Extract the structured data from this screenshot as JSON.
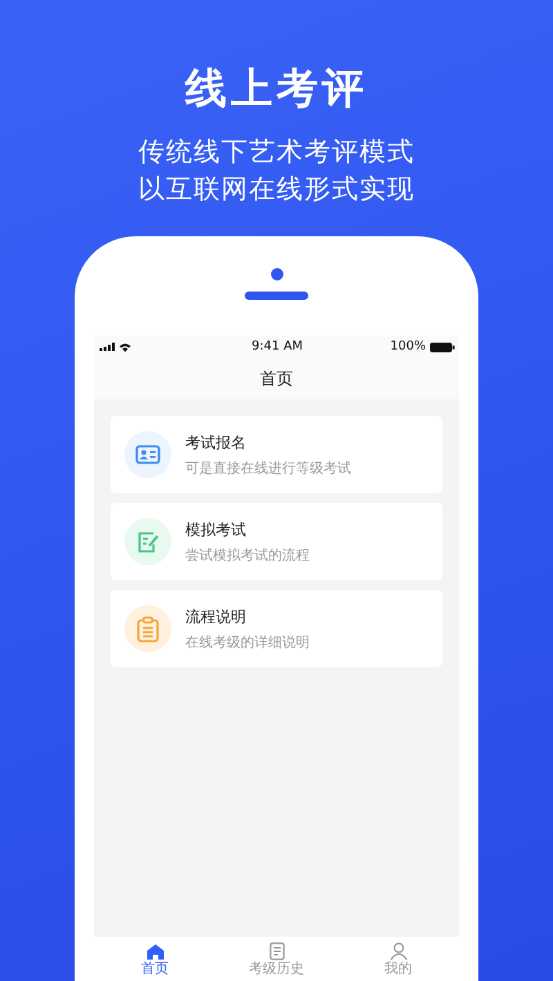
{
  "headline": "线上考评",
  "subtitle_lines": [
    "传统线下艺术考评模式",
    "以互联网在线形式实现"
  ],
  "status_bar": {
    "time": "9:41 AM",
    "battery": "100%"
  },
  "nav_title": "首页",
  "cards": [
    {
      "kind": "id-card",
      "title": "考试报名",
      "description": "可是直接在线进行等级考试"
    },
    {
      "kind": "edit",
      "title": "模拟考试",
      "description": "尝试模拟考试的流程"
    },
    {
      "kind": "clipboard",
      "title": "流程说明",
      "description": "在线考级的详细说明"
    }
  ],
  "tabs": [
    {
      "kind": "home",
      "label": "首页",
      "selected": true
    },
    {
      "kind": "document",
      "label": "考级历史",
      "selected": false
    },
    {
      "kind": "person",
      "label": "我的",
      "selected": false
    }
  ]
}
